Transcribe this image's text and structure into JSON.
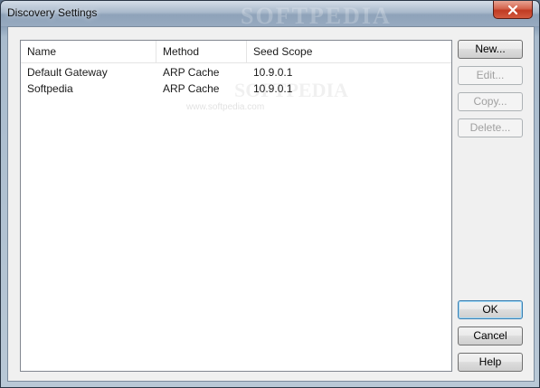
{
  "window": {
    "title": "Discovery Settings",
    "watermark": "SOFTPEDIA"
  },
  "list": {
    "columns": [
      "Name",
      "Method",
      "Seed Scope"
    ],
    "rows": [
      {
        "name": "Default Gateway",
        "method": "ARP Cache",
        "seed_scope": "10.9.0.1"
      },
      {
        "name": "Softpedia",
        "method": "ARP Cache",
        "seed_scope": "10.9.0.1"
      }
    ],
    "watermark": "SOFTPEDIA",
    "watermark_url": "www.softpedia.com"
  },
  "buttons": {
    "new": "New...",
    "edit": "Edit...",
    "copy": "Copy...",
    "delete": "Delete...",
    "ok": "OK",
    "cancel": "Cancel",
    "help": "Help"
  },
  "colors": {
    "close_button": "#c03a22",
    "default_button_border": "#3c7fb1"
  }
}
